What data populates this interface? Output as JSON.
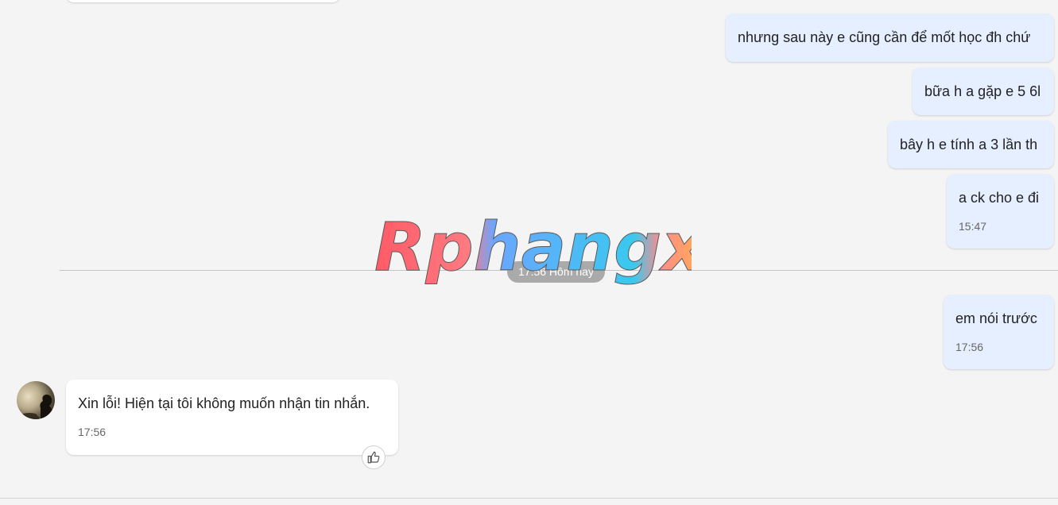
{
  "messages": [
    {
      "text": "nhưng sau này e cũng cần để mốt học đh chứ"
    },
    {
      "text": "bữa h a gặp e 5 6l"
    },
    {
      "text": "bây h e tính a 3 lần th"
    },
    {
      "text": "a ck cho e đi",
      "time": "15:47"
    },
    {
      "text": "em nói trước",
      "time": "17:56"
    },
    {
      "text": "Xin lỗi! Hiện tại tôi không muốn nhận tin nhắn.",
      "time": "17:56"
    }
  ],
  "divider": {
    "label": "17:56 Hôm nay"
  },
  "watermark": {
    "text": "Rphangx"
  },
  "icons": {
    "like": "thumbs-up-icon",
    "avatar": "contact-avatar"
  },
  "colors": {
    "outgoing_bubble": "#e5efff",
    "incoming_bubble": "#ffffff",
    "background": "#f4f4f4"
  }
}
